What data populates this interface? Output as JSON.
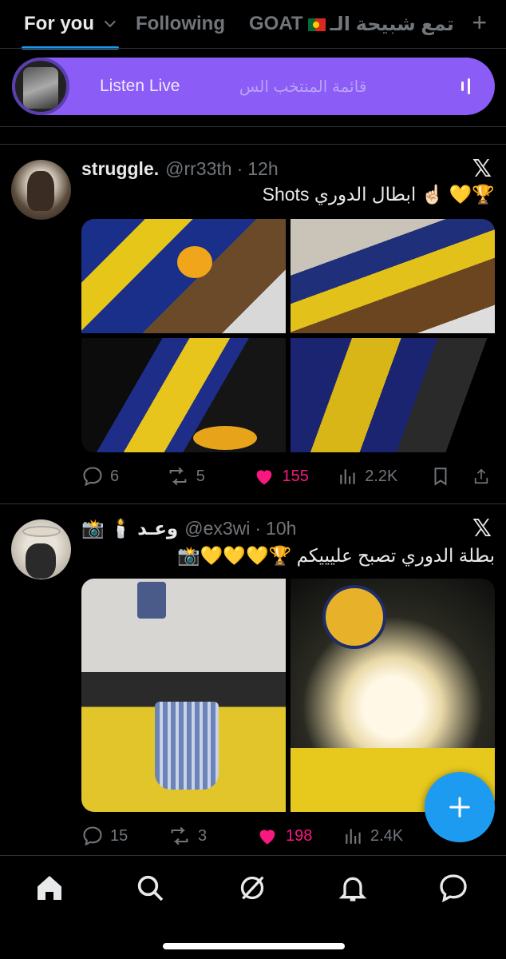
{
  "tabs": {
    "for_you": "For you",
    "following": "Following",
    "goat": "GOAT",
    "community": "تمع شبيحة الـ"
  },
  "live": {
    "label": "Listen Live",
    "ghost_text": "قائمة المنتخب الس"
  },
  "tweets": [
    {
      "name": "struggle.",
      "handle": "@rr33th",
      "dot": "·",
      "time": "12h",
      "text": "🏆💛 ☝🏻 ابطال الدوري Shots",
      "replies": "6",
      "reposts": "5",
      "likes": "155",
      "views": "2.2K"
    },
    {
      "name": "📸 🕯️ وعـد",
      "handle": "@ex3wi",
      "dot": "·",
      "time": "10h",
      "text": "بطلة الدوري تصبح عليييكم 🏆💛💛💛📸",
      "replies": "15",
      "reposts": "3",
      "likes": "198",
      "views": "2.4K"
    }
  ],
  "colors": {
    "accent": "#1d9bf0",
    "like": "#f91880",
    "live": "#8b5cf6",
    "muted": "#71767b",
    "text": "#e7e9ea"
  },
  "icons": [
    "chevron-down-icon",
    "plus-icon",
    "x-logo-icon",
    "reply-icon",
    "repost-icon",
    "heart-icon",
    "views-icon",
    "bookmark-icon",
    "share-icon",
    "home-icon",
    "search-icon",
    "grok-icon",
    "bell-icon",
    "messages-icon",
    "compose-icon"
  ]
}
